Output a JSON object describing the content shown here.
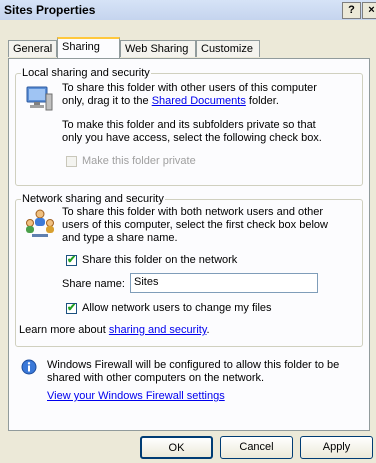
{
  "window": {
    "title": "Sites Properties",
    "help_glyph": "?",
    "close_glyph": "×"
  },
  "tabs": [
    {
      "label": "General"
    },
    {
      "label": "Sharing"
    },
    {
      "label": "Web Sharing"
    },
    {
      "label": "Customize"
    }
  ],
  "local": {
    "legend": "Local sharing and security",
    "line1": "To share this folder with other users of this computer",
    "line2_prefix": "only, drag it to the ",
    "line2_link": "Shared Documents",
    "line2_suffix": " folder.",
    "line3": "To make this folder and its subfolders private so that",
    "line4": "only you have access, select the following check box.",
    "private_label": "Make this folder private",
    "private_checked": false
  },
  "network": {
    "legend": "Network sharing and security",
    "line1": "To share this folder with both network users and other",
    "line2": "users of this computer, select the first check box below",
    "line3": "and type a share name.",
    "share_label": "Share this folder on the network",
    "share_checked": true,
    "share_name_label": "Share name:",
    "share_name_value": "Sites",
    "allow_label": "Allow network users to change my files",
    "allow_checked": true,
    "learn_prefix": "Learn more about ",
    "learn_link": "sharing and security",
    "learn_suffix": "."
  },
  "firewall": {
    "line1": "Windows Firewall will be configured to allow this folder to be",
    "line2": "shared with other computers on the network.",
    "link": "View your Windows Firewall settings"
  },
  "buttons": {
    "ok": "OK",
    "cancel": "Cancel",
    "apply": "Apply"
  },
  "icons": [
    "computer-monitor-icon",
    "network-users-icon",
    "info-icon",
    "checkmark-icon"
  ]
}
